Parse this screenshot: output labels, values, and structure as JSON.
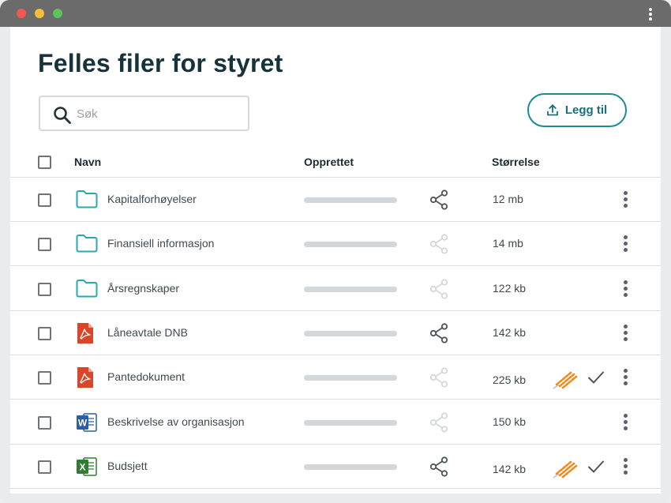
{
  "page": {
    "title": "Felles filer for styret",
    "search_placeholder": "Søk",
    "add_button_label": "Legg til"
  },
  "table": {
    "headers": {
      "name": "Navn",
      "created": "Opprettet",
      "size": "Størrelse"
    },
    "rows": [
      {
        "name": "Kapitalforhøyelser",
        "size": "12 mb",
        "type": "folder-icon",
        "shared": true,
        "signed": false
      },
      {
        "name": "Finansiell informasjon",
        "size": "14 mb",
        "type": "folder-icon",
        "shared": false,
        "signed": false
      },
      {
        "name": "Årsregnskaper",
        "size": "122 kb",
        "type": "folder-icon",
        "shared": false,
        "signed": false
      },
      {
        "name": "Låneavtale DNB",
        "size": "142 kb",
        "type": "pdf-icon",
        "shared": true,
        "signed": false
      },
      {
        "name": "Pantedokument",
        "size": "225 kb",
        "type": "pdf-icon",
        "shared": false,
        "signed": true
      },
      {
        "name": "Beskrivelse av organisasjon",
        "size": "150 kb",
        "type": "word-icon",
        "shared": false,
        "signed": false
      },
      {
        "name": "Budsjett",
        "size": "142 kb",
        "type": "excel-icon",
        "shared": true,
        "signed": true
      }
    ]
  },
  "colors": {
    "accent": "#1f8a93",
    "title": "#16323a",
    "folder": "#2aa9b0",
    "pdf": "#d9472b",
    "word": "#2b5ca8",
    "excel": "#2e7d32",
    "sign": "#f08a1c"
  }
}
